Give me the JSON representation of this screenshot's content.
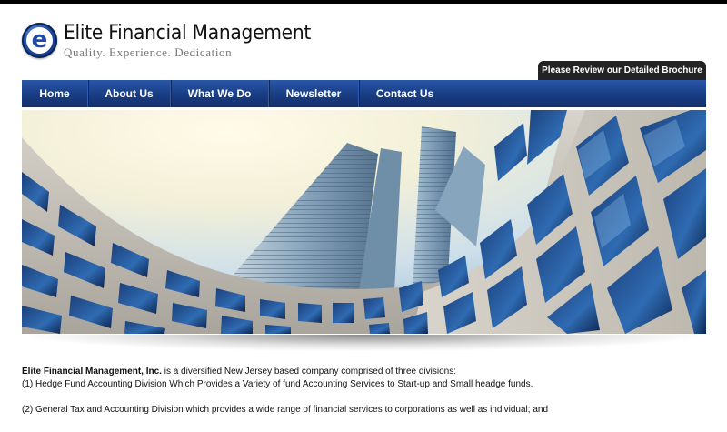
{
  "header": {
    "brand_name": "Elite Financial Management",
    "tagline": "Quality. Experience. Dedication",
    "logo_letter": "e",
    "brochure_link": "Please Review our Detailed Brochure"
  },
  "nav": {
    "items": [
      {
        "label": "Home"
      },
      {
        "label": "About Us"
      },
      {
        "label": "What We Do"
      },
      {
        "label": "Newsletter"
      },
      {
        "label": "Contact Us"
      }
    ]
  },
  "hero": {
    "description_icon": "skyscraper-photo"
  },
  "content": {
    "intro_company": "Elite Financial Management, Inc.",
    "intro_rest": " is a diversified New Jersey based company comprised of three divisions:",
    "line1": "(1) Hedge Fund Accounting Division Which Provides a Variety of fund Accounting Services to Start-up and Small headge funds.",
    "line2": "(2) General Tax and Accounting Division which provides a wide range of financial services to corporations as well as individual; and"
  },
  "colors": {
    "nav_blue": "#1a3f86",
    "brochure_tab": "#232323",
    "logo_blue": "#1d4aa8"
  }
}
